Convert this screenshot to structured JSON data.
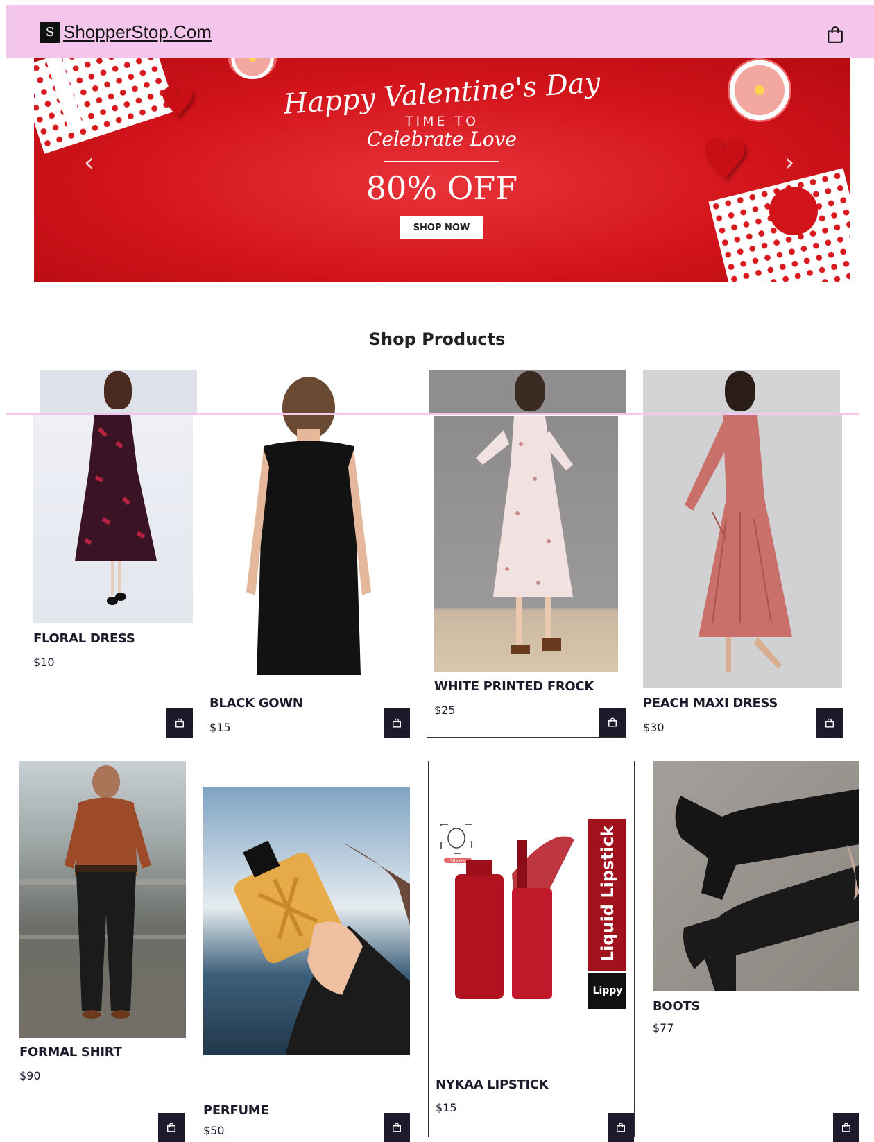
{
  "header": {
    "brand": "ShopperStop.Com",
    "logo_letter": "S",
    "cart_icon": "shopping-bag-icon",
    "bg_color": "#f4c6eb"
  },
  "banner": {
    "title": "Happy Valentine's Day",
    "subtitle": "TIME TO",
    "subtitle2": "Celebrate Love",
    "offer": "80% OFF",
    "button": "SHOP NOW",
    "prev_icon": "chevron-left-icon",
    "next_icon": "chevron-right-icon"
  },
  "section": {
    "title": "Shop Products"
  },
  "products": [
    {
      "name": "FLORAL DRESS",
      "price": "$10"
    },
    {
      "name": "BLACK GOWN",
      "price": "$15"
    },
    {
      "name": "WHITE PRINTED FROCK",
      "price": "$25"
    },
    {
      "name": "PEACH MAXI DRESS",
      "price": "$30"
    },
    {
      "name": "FORMAL SHIRT",
      "price": "$90"
    },
    {
      "name": "PERFUME",
      "price": "$50"
    },
    {
      "name": "NYKAA LIPSTICK",
      "price": "$15"
    },
    {
      "name": "BOOTS",
      "price": "$77"
    }
  ],
  "lipstick_art": {
    "label": "Liquid Lipstick",
    "tag": "Lippy",
    "try_on": "TRY-ON"
  },
  "colors": {
    "accent": "#1c1a2b",
    "banner_red": "#d3141b",
    "header_pink": "#f4c6eb"
  }
}
